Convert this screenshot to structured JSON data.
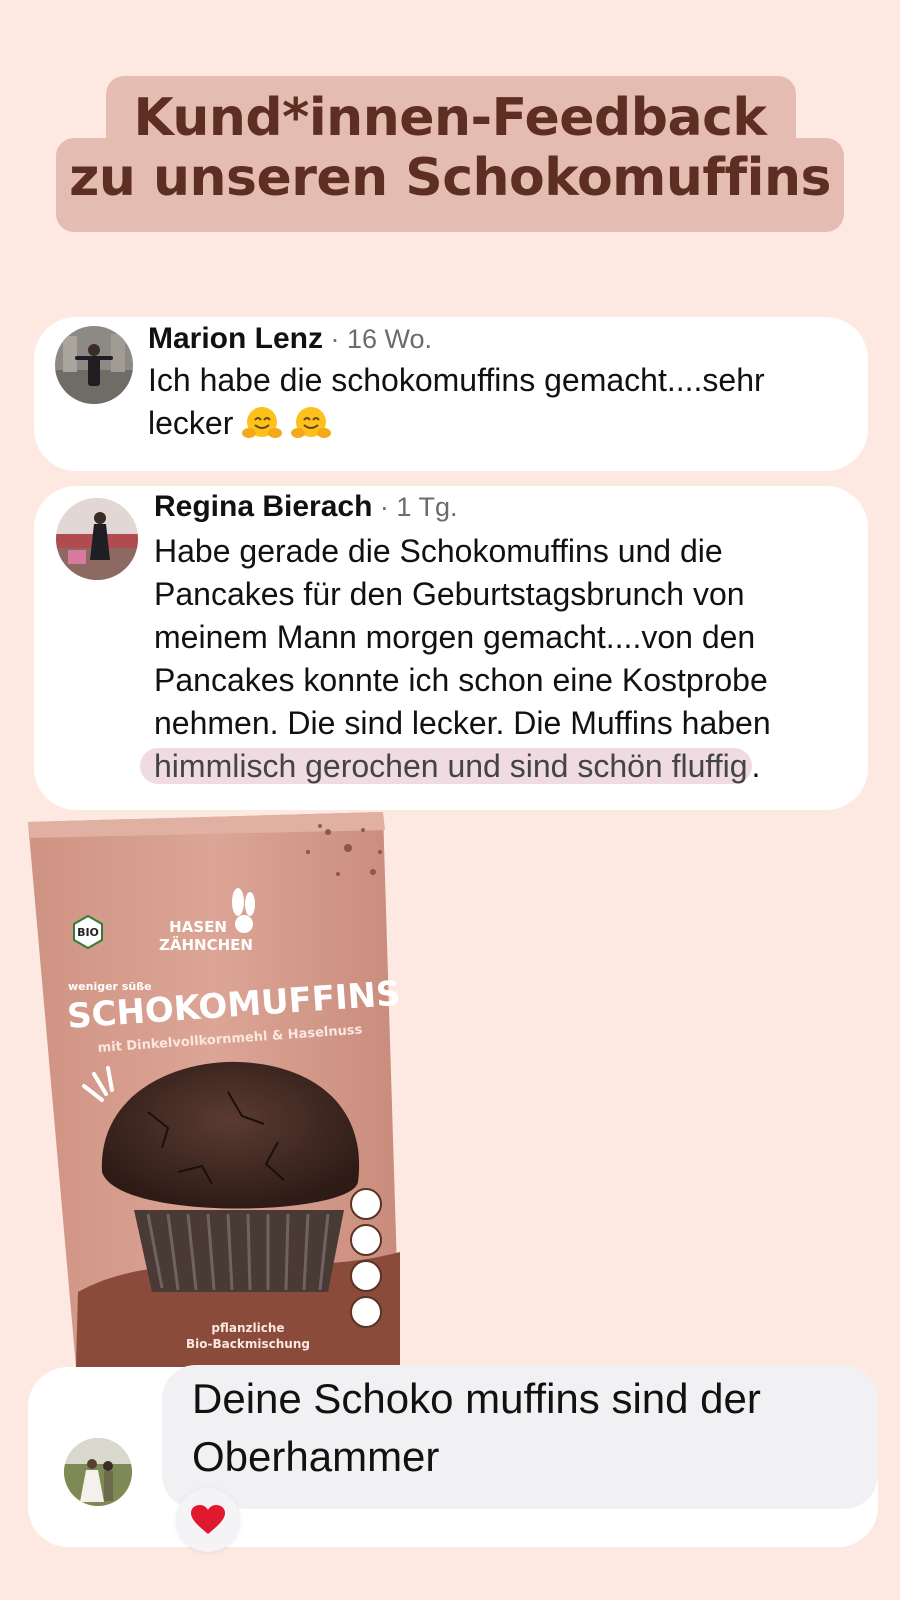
{
  "title": {
    "line1": "Kund*innen-Feedback",
    "line2": "zu unseren Schokomuffins"
  },
  "comments": [
    {
      "name": "Marion Lenz",
      "meta": " · 16 Wo.",
      "line1": "Ich habe die schokomuffins gemacht....sehr",
      "line2": "lecker"
    },
    {
      "name": "Regina Bierach",
      "meta": " · 1 Tg.",
      "lines": [
        "Habe gerade die Schokomuffins und die",
        "Pancakes für den Geburtstagsbrunch von",
        "meinem Mann morgen gemacht....von den",
        "Pancakes konnte ich schon eine Kostprobe",
        "nehmen. Die sind lecker. Die Muffins haben"
      ],
      "highlight": "himmlisch gerochen und sind schön fluffig",
      "end": "."
    },
    {
      "line1": "Deine Schoko muffins sind der",
      "line2": "Oberhammer",
      "reaction": "heart"
    }
  ],
  "product": {
    "brand_line1": "HASEN",
    "brand_line2": "ZÄHNCHEN",
    "bio_badge": "BIO",
    "tag": "weniger süße",
    "name": "SCHOKOMUFFINS",
    "subtitle": "mit Dinkelvollkornmehl & Haselnuss",
    "bottom1": "pflanzliche",
    "bottom2": "Bio-Backmischung",
    "icons": [
      "vegan-icon",
      "bio-icon",
      "fruit-sweet-icon",
      "fiber-icon"
    ]
  },
  "colors": {
    "background": "#fde9e1",
    "title_bg": "#e5bcb1",
    "title_text": "#5e2e22",
    "bag": "#d49a8a",
    "highlight": "#efdbe1"
  }
}
